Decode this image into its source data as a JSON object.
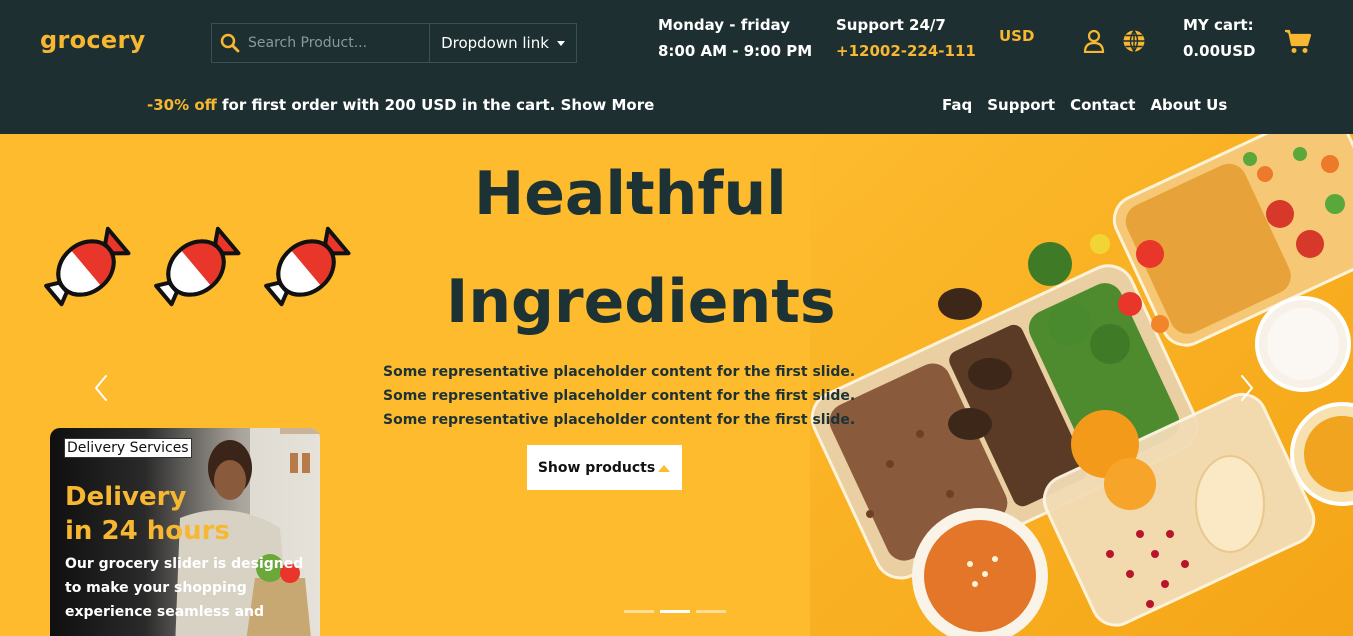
{
  "header": {
    "logo": "grocery",
    "search_placeholder": "Search Product...",
    "dropdown_label": "Dropdown link",
    "hours_line1": "Monday - friday",
    "hours_line2": "8:00 AM - 9:00 PM",
    "support_title": "Support 24/7",
    "support_phone": "+12002-224-111",
    "currency": "USD",
    "cart_label": "MY cart:",
    "cart_total": "0.00USD",
    "promo_highlight": "-30% off",
    "promo_text": " for first order with 200 USD in the cart. Show More",
    "nav": [
      "Faq",
      "Support",
      "Contact",
      "About Us"
    ],
    "accent_color": "#f7b731",
    "bg_color": "#1d2f30"
  },
  "hero": {
    "title_line1": "Healthful",
    "title_line2": "Ingredients",
    "description": [
      "Some representative placeholder content for the first slide.",
      "Some representative placeholder content for the first slide.",
      "Some representative placeholder content for the first slide."
    ],
    "button_label": "Show products",
    "active_slide": 2,
    "slide_count": 3,
    "bg_color": "#fdbb2d"
  },
  "delivery_card": {
    "label": "Delivery Services",
    "title_line1": "Delivery",
    "title_line2": "in 24 hours",
    "text": "Our grocery slider is designed to make your shopping experience seamless and"
  }
}
